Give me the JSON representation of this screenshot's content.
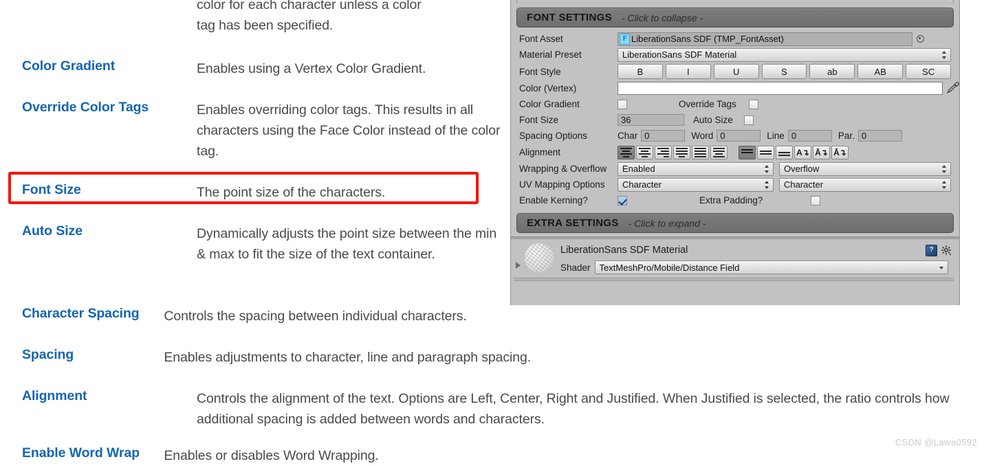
{
  "doc": {
    "continuation_lines": [
      "color for each character unless a color",
      "tag has been specified."
    ],
    "entries": [
      {
        "term": "Color Gradient",
        "desc": "Enables using a Vertex Color Gradient."
      },
      {
        "term": "Override Color Tags",
        "desc": "Enables overriding color tags. This results in all characters using the Face Color instead of the color tag."
      },
      {
        "term": "Font Size",
        "desc": "The point size of the characters.",
        "highlighted": true
      },
      {
        "term": "Auto Size",
        "desc": "Dynamically adjusts the point size between the min & max to fit the size of the text container."
      },
      {
        "term": "Character Spacing",
        "desc": "Controls the spacing between individual characters."
      },
      {
        "term": "Spacing",
        "desc": "Enables adjustments to character, line and paragraph spacing."
      },
      {
        "term": "Alignment",
        "desc": "Controls the alignment of the text. Options are Left, Center, Right and Justified. When Justified is selected, the ratio controls how additional spacing is added between words and characters."
      },
      {
        "term": "Enable Word Wrap",
        "desc": "Enables or disables Word Wrapping."
      }
    ],
    "term_color": "#1565b0",
    "desc_color": "#4a4a4a",
    "highlight_color": "#fa1400",
    "watermark": "CSDN @Lawa0592"
  },
  "inspector": {
    "font_settings": {
      "title": "FONT SETTINGS",
      "hint": "- Click to collapse -"
    },
    "extra_settings": {
      "title": "EXTRA SETTINGS",
      "hint": "- Click to expand -"
    },
    "font_asset": {
      "label": "Font Asset",
      "badge": "F",
      "value": "LiberationSans SDF (TMP_FontAsset)",
      "picker_icon": "circle-select-icon"
    },
    "material_preset": {
      "label": "Material Preset",
      "value": "LiberationSans SDF Material"
    },
    "font_style": {
      "label": "Font Style",
      "buttons": [
        "B",
        "I",
        "U",
        "S",
        "ab",
        "AB",
        "SC"
      ]
    },
    "color_vertex": {
      "label": "Color (Vertex)",
      "value": "#ffffff",
      "eyedropper_icon": "eyedropper-icon"
    },
    "color_gradient": {
      "label": "Color Gradient",
      "checked": false,
      "override_label": "Override Tags",
      "override_checked": false
    },
    "font_size": {
      "label": "Font Size",
      "value": "36",
      "auto_size_label": "Auto Size",
      "auto_size_checked": false
    },
    "spacing_options": {
      "label": "Spacing Options",
      "fields": [
        {
          "name": "Char",
          "value": "0"
        },
        {
          "name": "Word",
          "value": "0"
        },
        {
          "name": "Line",
          "value": "0"
        },
        {
          "name": "Par.",
          "value": "0"
        }
      ]
    },
    "alignment": {
      "label": "Alignment",
      "horizontal": [
        {
          "icon": "align-left-icon",
          "selected": true
        },
        {
          "icon": "align-center-icon",
          "selected": false
        },
        {
          "icon": "align-right-icon",
          "selected": false
        },
        {
          "icon": "align-justified-icon",
          "selected": false
        },
        {
          "icon": "align-flush-icon",
          "selected": false
        },
        {
          "icon": "align-geometry-icon",
          "selected": false
        }
      ],
      "vertical": [
        {
          "icon": "align-top-icon",
          "selected": true
        },
        {
          "icon": "align-middle-icon",
          "selected": false
        },
        {
          "icon": "align-bottom-icon",
          "selected": false
        },
        {
          "icon": "align-baseline-icon",
          "selected": false
        },
        {
          "icon": "align-midline-icon",
          "selected": false
        },
        {
          "icon": "align-capline-icon",
          "selected": false
        }
      ]
    },
    "wrapping_overflow": {
      "label": "Wrapping & Overflow",
      "wrapping_value": "Enabled",
      "overflow_value": "Overflow"
    },
    "uv_mapping": {
      "label": "UV Mapping Options",
      "horizontal_value": "Character",
      "vertical_value": "Character"
    },
    "kerning": {
      "label": "Enable Kerning?",
      "checked": true,
      "padding_label": "Extra Padding?",
      "padding_checked": false
    },
    "material": {
      "name": "LiberationSans SDF Material",
      "shader_label": "Shader",
      "shader_value": "TextMeshPro/Mobile/Distance Field",
      "help_icon": "help-book-icon",
      "settings_icon": "gear-icon",
      "preview_icon": "material-sphere-preview"
    }
  }
}
